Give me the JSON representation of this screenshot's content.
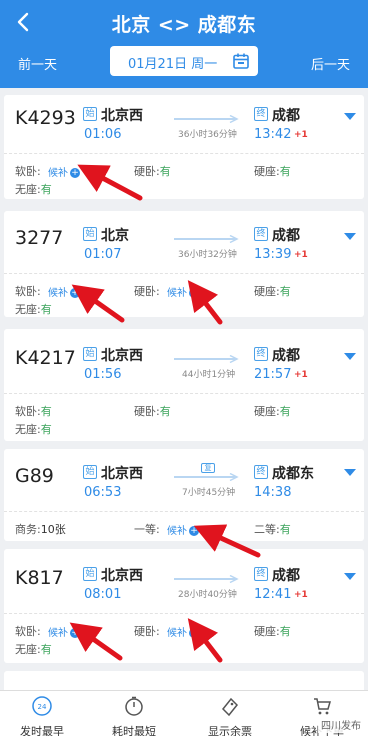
{
  "header": {
    "title": "北京 <> 成都东",
    "prev_day": "前一天",
    "next_day": "后一天",
    "date": "01月21日 周一"
  },
  "trains": [
    {
      "number": "K4293",
      "from_badge": "始",
      "from": "北京西",
      "depart": "01:06",
      "duration": "36小时36分钟",
      "to_badge": "终",
      "to": "成都",
      "arrive": "13:42",
      "day_offset": "+1",
      "seats": [
        {
          "label": "软卧:",
          "value": "候补",
          "waitlist": true
        },
        {
          "label": "硬卧:",
          "value": "有"
        },
        {
          "label": "硬座:",
          "value": "有"
        },
        {
          "label": "无座:",
          "value": "有"
        }
      ]
    },
    {
      "number": "3277",
      "from_badge": "始",
      "from": "北京",
      "depart": "01:07",
      "duration": "36小时32分钟",
      "to_badge": "终",
      "to": "成都",
      "arrive": "13:39",
      "day_offset": "+1",
      "seats": [
        {
          "label": "软卧:",
          "value": "候补",
          "waitlist": true
        },
        {
          "label": "硬卧:",
          "value": "候补",
          "waitlist": true
        },
        {
          "label": "硬座:",
          "value": "有"
        },
        {
          "label": "无座:",
          "value": "有"
        }
      ]
    },
    {
      "number": "K4217",
      "from_badge": "始",
      "from": "北京西",
      "depart": "01:56",
      "duration": "44小时1分钟",
      "to_badge": "终",
      "to": "成都",
      "arrive": "21:57",
      "day_offset": "+1",
      "seats": [
        {
          "label": "软卧:",
          "value": "有"
        },
        {
          "label": "硬卧:",
          "value": "有"
        },
        {
          "label": "硬座:",
          "value": "有"
        },
        {
          "label": "无座:",
          "value": "有"
        }
      ]
    },
    {
      "number": "G89",
      "from_badge": "始",
      "from": "北京西",
      "depart": "06:53",
      "fast_badge": "复",
      "duration": "7小时45分钟",
      "to_badge": "终",
      "to": "成都东",
      "arrive": "14:38",
      "seats": [
        {
          "label": "商务:",
          "value": "10张"
        },
        {
          "label": "一等:",
          "value": "候补",
          "waitlist": true
        },
        {
          "label": "二等:",
          "value": "有"
        }
      ]
    },
    {
      "number": "K817",
      "from_badge": "始",
      "from": "北京西",
      "depart": "08:01",
      "duration": "28小时40分钟",
      "to_badge": "终",
      "to": "成都",
      "arrive": "12:41",
      "day_offset": "+1",
      "seats": [
        {
          "label": "软卧:",
          "value": "候补",
          "waitlist": true
        },
        {
          "label": "硬卧:",
          "value": "候补",
          "waitlist": true
        },
        {
          "label": "硬座:",
          "value": "有"
        },
        {
          "label": "无座:",
          "value": "有"
        }
      ]
    }
  ],
  "bottom_tabs": [
    {
      "label": "发时最早",
      "icon": "clock-24-icon"
    },
    {
      "label": "耗时最短",
      "icon": "stopwatch-icon"
    },
    {
      "label": "显示余票",
      "icon": "ticket-icon"
    },
    {
      "label": "候补下单",
      "icon": "cart-icon"
    }
  ],
  "clock_icon_text": "24",
  "watermark": "四川发布",
  "colors": {
    "header_bg": "#2f8be6",
    "accent": "#2f8be6",
    "available": "#3aa35a",
    "day_offset": "#e53935",
    "annotation_arrow": "#e0141e"
  }
}
